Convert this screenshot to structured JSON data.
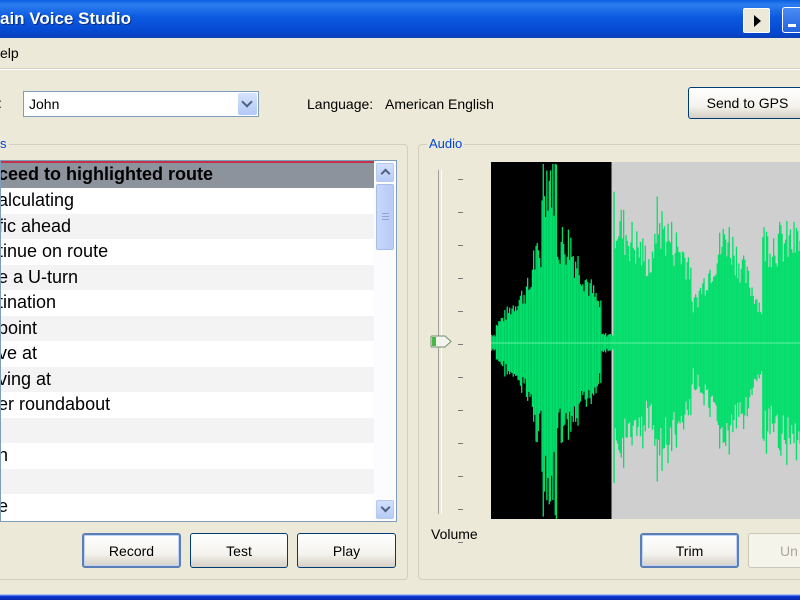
{
  "window": {
    "title": "ain Voice Studio",
    "controls": {
      "help_arrow": "context-arrow-icon",
      "minimize": "minimize-icon"
    }
  },
  "menu": {
    "items": [
      {
        "label": "Help",
        "visible_text": "elp"
      }
    ]
  },
  "voice": {
    "label_fragment": ":",
    "selected": "John",
    "dropdown_icon": "chevron-down-icon"
  },
  "language": {
    "label": "Language:",
    "value": "American English"
  },
  "send_button": {
    "label": "Send to GPS"
  },
  "phrases_group": {
    "title_fragment": "s",
    "items": [
      {
        "text": "ceed to highlighted route",
        "selected": true
      },
      {
        "text": "alculating"
      },
      {
        "text": "fic ahead"
      },
      {
        "text": "tinue on route"
      },
      {
        "text": "e a U-turn"
      },
      {
        "text": "tination"
      },
      {
        "text": "point"
      },
      {
        "text": "ve at"
      },
      {
        "text": "ving at"
      },
      {
        "text": "er roundabout"
      },
      {
        "text": ""
      },
      {
        "text": "n"
      },
      {
        "text": ""
      },
      {
        "text": "e"
      }
    ],
    "buttons": {
      "record": "Record",
      "test": "Test",
      "play": "Play"
    }
  },
  "audio_group": {
    "title": "Audio",
    "volume_label": "Volume",
    "volume_level": 0.5,
    "selection_fraction": [
      0.0,
      0.39
    ],
    "colors": {
      "waveform": "#00e06a",
      "selected_bg": "#000000",
      "unselected_bg": "#cfcfcf"
    },
    "buttons": {
      "trim": "Trim",
      "undo_fragment": "Un"
    }
  }
}
